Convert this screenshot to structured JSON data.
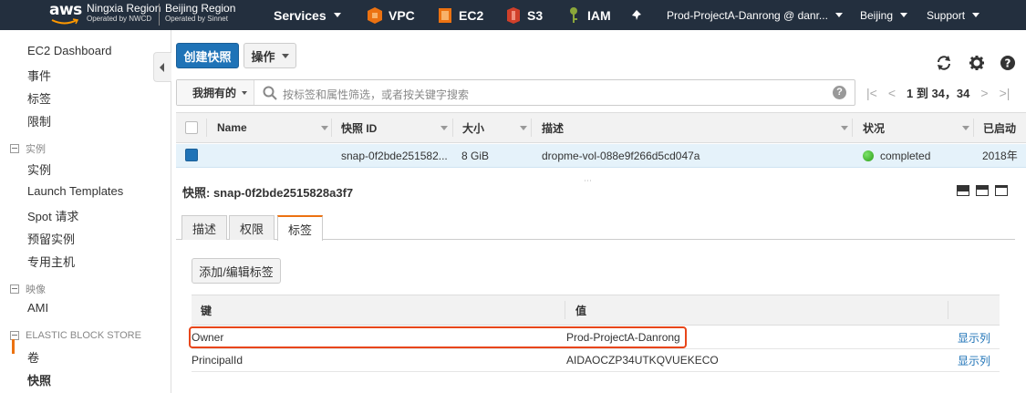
{
  "nav": {
    "logo": "aws",
    "region1": {
      "name": "Ningxia Region",
      "sub": "Operated by NWCD"
    },
    "region2": {
      "name": "Beijing Region",
      "sub": "Operated by Sinnet"
    },
    "services": "Services",
    "vpc": "VPC",
    "ec2": "EC2",
    "s3": "S3",
    "iam": "IAM",
    "account": "Prod-ProjectA-Danrong @ danr...",
    "region": "Beijing",
    "support": "Support"
  },
  "sidebar": {
    "items": [
      {
        "label": "EC2 Dashboard"
      },
      {
        "label": "事件"
      },
      {
        "label": "标签"
      },
      {
        "label": "限制"
      }
    ],
    "section_instances": "实例",
    "instances_items": [
      {
        "label": "实例"
      },
      {
        "label": "Launch Templates"
      },
      {
        "label": "Spot 请求"
      },
      {
        "label": "预留实例"
      },
      {
        "label": "专用主机"
      }
    ],
    "section_images": "映像",
    "images_items": [
      {
        "label": "AMI"
      }
    ],
    "section_ebs": "ELASTIC BLOCK STORE",
    "ebs_items": [
      {
        "label": "卷"
      },
      {
        "label": "快照"
      }
    ],
    "active_color": "#ec7211"
  },
  "toolbar": {
    "create_snapshot": "创建快照",
    "actions": "操作",
    "icons": [
      "refresh-icon",
      "gear-icon",
      "help-icon"
    ]
  },
  "filter": {
    "owned_by_me": "我拥有的",
    "placeholder": "按标签和属性筛选，或者按关键字搜索",
    "help": "?"
  },
  "pager": {
    "first": "|<",
    "prev": "<",
    "text": "1 到 34，34",
    "next": ">",
    "last": ">|"
  },
  "grid": {
    "columns": [
      "Name",
      "快照 ID",
      "大小",
      "描述",
      "状况",
      "已启动"
    ],
    "rows": [
      {
        "name": "",
        "snapshot_id": "snap-0f2bde251582...",
        "size": "8 GiB",
        "description": "dropme-vol-088e9f266d5cd047a",
        "status": "completed",
        "started": "2018年"
      }
    ],
    "resize_handle": "⋯"
  },
  "detail": {
    "title": "快照: snap-0f2bde2515828a3f7",
    "tabs": [
      "描述",
      "权限",
      "标签"
    ],
    "active_tab": "标签",
    "add_edit_tags": "添加/编辑标签",
    "tag_columns": {
      "key": "键",
      "value": "值"
    },
    "tags": [
      {
        "key": "Owner",
        "value": "Prod-ProjectA-Danrong",
        "link": "显示列"
      },
      {
        "key": "PrincipalId",
        "value": "AIDAOCZP34UTKQVUEKECO",
        "link": "显示列"
      }
    ]
  },
  "colors": {
    "nav_bg": "#232f3e",
    "primary": "#1f73b7",
    "accent": "#ec7211",
    "highlight": "#e8461a",
    "row_selected": "#e5f2fa"
  }
}
